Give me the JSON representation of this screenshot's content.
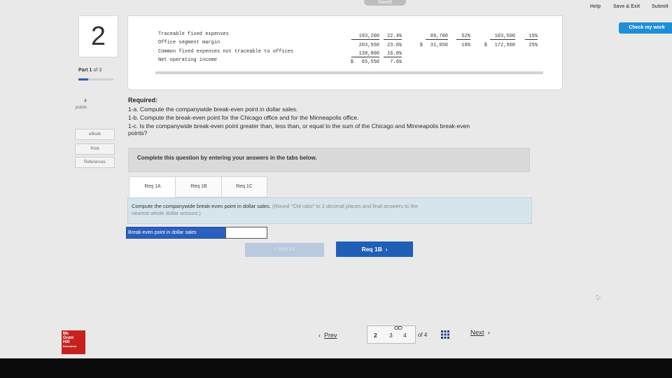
{
  "header": {
    "saved": "Saved",
    "help": "Help",
    "save_exit": "Save & Exit",
    "submit": "Submit",
    "check_work": "Check my work"
  },
  "question": {
    "number": "2",
    "part": "Part 1",
    "part_of": "of 3",
    "part_progress": 0.33,
    "points_value": "4",
    "points_label": "points"
  },
  "side_links": [
    "eBook",
    "Print",
    "References"
  ],
  "table": {
    "rows": [
      {
        "label": "Traceable fixed expenses",
        "total": "193,200",
        "total_pct": "22.4%",
        "chicago_dollar": "",
        "chicago": "89,700",
        "chicago_pct": "52%",
        "mpls_dollar": "",
        "mpls": "103,500",
        "mpls_pct": "15%"
      },
      {
        "label": "Office segment margin",
        "total": "203,550",
        "total_pct": "23.6%",
        "chicago_dollar": "$",
        "chicago": "31,050",
        "chicago_pct": "18%",
        "mpls_dollar": "$",
        "mpls": "172,500",
        "mpls_pct": "25%"
      },
      {
        "label": "Common fixed expenses not traceable to offices",
        "total": "138,000",
        "total_pct": "16.0%",
        "chicago_dollar": "",
        "chicago": "",
        "chicago_pct": "",
        "mpls_dollar": "",
        "mpls": "",
        "mpls_pct": ""
      },
      {
        "label": "Net operating income",
        "total_dollar": "$",
        "total": "65,550",
        "total_pct": "7.6%",
        "chicago": "",
        "chicago_pct": "",
        "mpls": "",
        "mpls_pct": ""
      }
    ]
  },
  "required": {
    "title": "Required:",
    "items": [
      "1-a. Compute the companywide break-even point in dollar sales.",
      "1-b. Compute the break-even point for the Chicago office and for the Minneapolis office.",
      "1-c. Is the companywide break-even point greater than, less than, or equal to the sum of the Chicago and Minneapolis break-even",
      "points?"
    ]
  },
  "complete_text": "Complete this question by entering your answers in the tabs below.",
  "tabs": [
    "Req 1A",
    "Req 1B",
    "Req 1C"
  ],
  "instruction": {
    "main": "Compute the companywide break-even point in dollar sales.",
    "note": "(Round \"CM ratio\" to 2 decimal places and final answers to the",
    "note2": "nearest whole dollar amount.)"
  },
  "answer": {
    "label": "Break-even point in dollar sales",
    "value": ""
  },
  "req_nav": {
    "prev_label": "Req 1A",
    "next_label": "Req 1B"
  },
  "footer": {
    "logo_lines": [
      "Mc",
      "Graw",
      "Hill",
      "Education"
    ],
    "prev": "Prev",
    "pages": [
      "2",
      "3",
      "4"
    ],
    "of_text": "of 4",
    "next": "Next"
  }
}
